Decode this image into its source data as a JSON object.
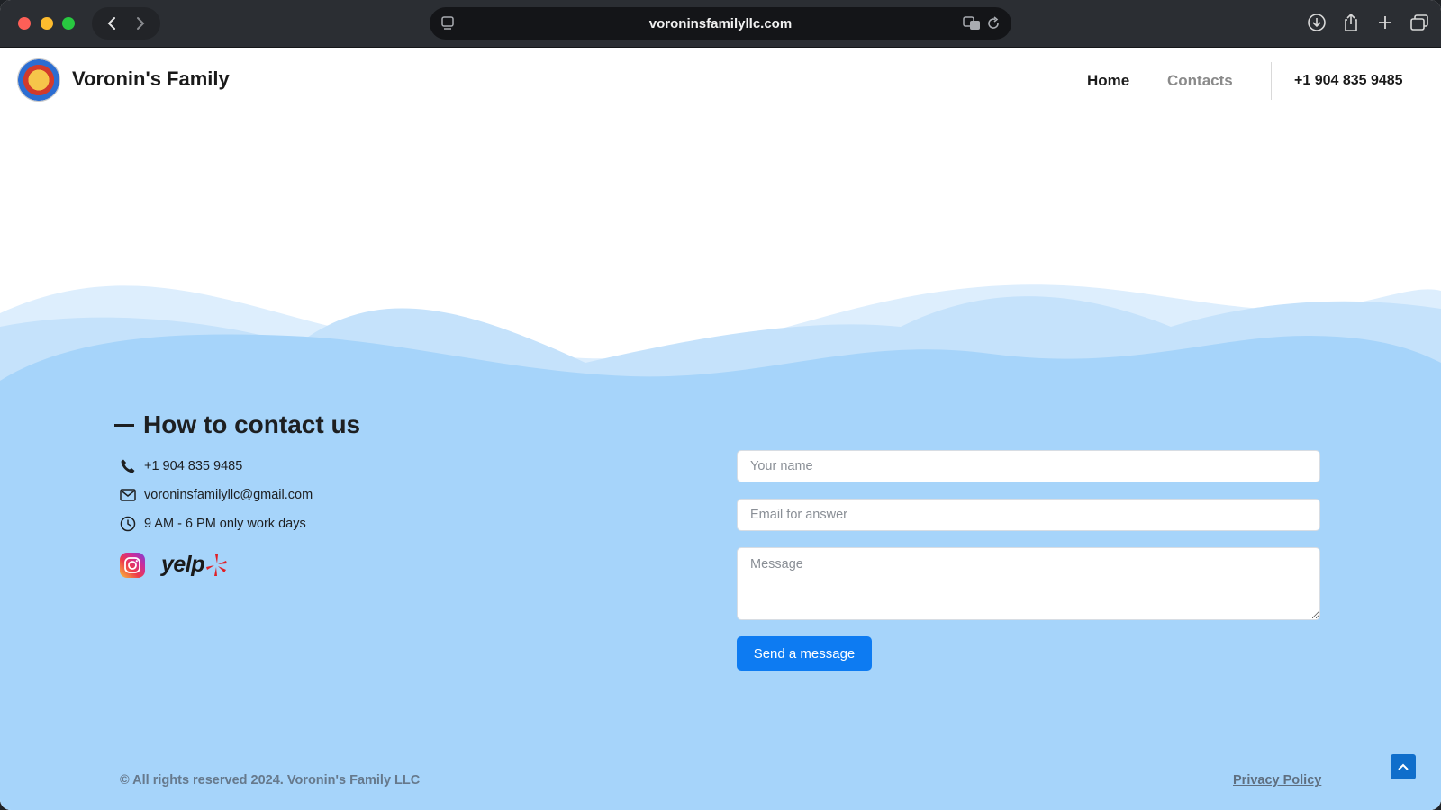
{
  "browser": {
    "url": "voroninsfamilyllc.com",
    "icons": [
      "back-icon",
      "forward-icon",
      "tab-overview-icon",
      "translate-icon",
      "reload-icon",
      "download-icon",
      "share-icon",
      "new-tab-icon",
      "tabs-icon"
    ]
  },
  "header": {
    "brand": "Voronin's Family",
    "nav": {
      "home": "Home",
      "contacts": "Contacts"
    },
    "phone": "+1 904 835 9485"
  },
  "contact": {
    "title": "How to contact us",
    "phone": "+1 904 835 9485",
    "email": "voroninsfamilyllc@gmail.com",
    "hours": "9 AM - 6 PM only work days",
    "social": {
      "yelp": "yelp"
    }
  },
  "form": {
    "name_placeholder": "Your name",
    "email_placeholder": "Email for answer",
    "message_placeholder": "Message",
    "send_label": "Send a message"
  },
  "footer": {
    "copyright": "© All rights reserved 2024. Voronin's Family LLC",
    "privacy": "Privacy Policy"
  },
  "colors": {
    "chrome": "#2b2e33",
    "contact_bg": "#a6d4fa",
    "accent": "#0d7bf2",
    "scroll_top": "#0f6ecb"
  }
}
